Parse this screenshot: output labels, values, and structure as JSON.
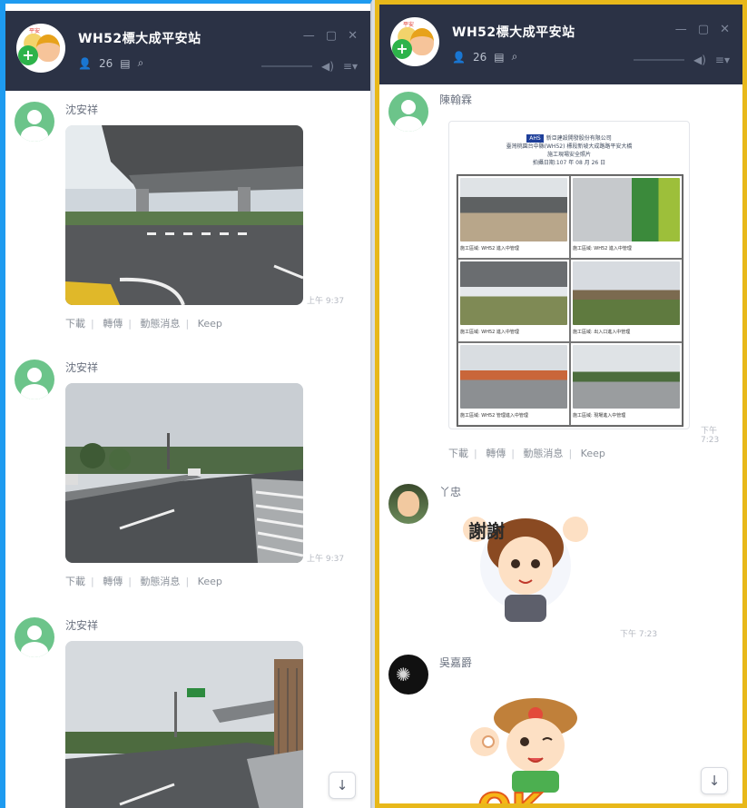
{
  "group": {
    "title": "WH52標大成平安站",
    "members_count": "26",
    "win_min": "—",
    "win_max": "▢",
    "win_close": "✕",
    "mute_icon": "◀)",
    "menu_icon": "≡▾"
  },
  "left": {
    "messages": [
      {
        "sender": "沈安祥",
        "time": "上午 9:37"
      },
      {
        "sender": "沈安祥",
        "time": "上午 9:37"
      },
      {
        "sender": "沈安祥",
        "time": ""
      }
    ],
    "actions": [
      "下載",
      "轉傳",
      "動態消息",
      "Keep"
    ]
  },
  "right": {
    "messages": [
      {
        "sender": "陳翰霖",
        "time": "下午 7:23"
      },
      {
        "sender": "丫忠",
        "time": "下午 7:23"
      },
      {
        "sender": "吳嘉爵",
        "time": ""
      }
    ],
    "actions": [
      "下載",
      "轉傳",
      "動態消息",
      "Keep"
    ],
    "document": {
      "logo": "AHS",
      "company": "新亞建設開發股份有限公司",
      "line2": "臺灣桃園台中縣(WH52) 標段新坡大成路路平安大橋",
      "line3": "施工現場安全照片",
      "date": "拍攝日期:107 年 08 月 26 日",
      "captions": [
        "施工區域: WH52 進入中管理",
        "施工區域: WH52 進入中管理",
        "施工區域: WH52 進入中管理",
        "施工區域: 出入口進入中管理",
        "施工區域: WH52 管理進入中管理",
        "施工區域: 現場進入中管理"
      ]
    },
    "sticker_thanks": "謝謝",
    "sticker_ok": "OK"
  },
  "scroll_down_icon": "↓",
  "colors": {
    "header_bg": "#2b3245",
    "left_frame": "#1e9bf0",
    "right_frame": "#e8b81a",
    "avatar_green": "#6cc48a"
  }
}
